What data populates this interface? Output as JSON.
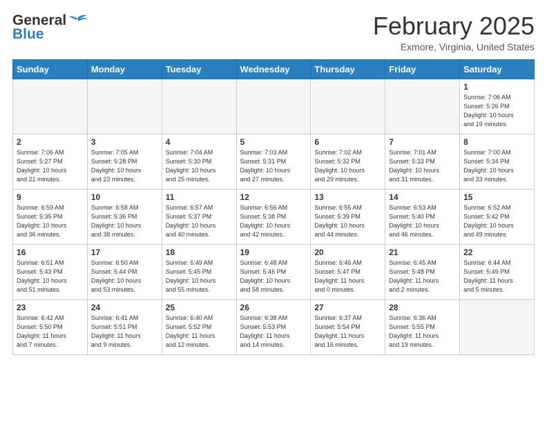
{
  "header": {
    "logo_general": "General",
    "logo_blue": "Blue",
    "month_title": "February 2025",
    "location": "Exmore, Virginia, United States"
  },
  "days_of_week": [
    "Sunday",
    "Monday",
    "Tuesday",
    "Wednesday",
    "Thursday",
    "Friday",
    "Saturday"
  ],
  "weeks": [
    [
      {
        "day": "",
        "info": ""
      },
      {
        "day": "",
        "info": ""
      },
      {
        "day": "",
        "info": ""
      },
      {
        "day": "",
        "info": ""
      },
      {
        "day": "",
        "info": ""
      },
      {
        "day": "",
        "info": ""
      },
      {
        "day": "1",
        "info": "Sunrise: 7:06 AM\nSunset: 5:26 PM\nDaylight: 10 hours\nand 19 minutes."
      }
    ],
    [
      {
        "day": "2",
        "info": "Sunrise: 7:06 AM\nSunset: 5:27 PM\nDaylight: 10 hours\nand 21 minutes."
      },
      {
        "day": "3",
        "info": "Sunrise: 7:05 AM\nSunset: 5:28 PM\nDaylight: 10 hours\nand 23 minutes."
      },
      {
        "day": "4",
        "info": "Sunrise: 7:04 AM\nSunset: 5:30 PM\nDaylight: 10 hours\nand 25 minutes."
      },
      {
        "day": "5",
        "info": "Sunrise: 7:03 AM\nSunset: 5:31 PM\nDaylight: 10 hours\nand 27 minutes."
      },
      {
        "day": "6",
        "info": "Sunrise: 7:02 AM\nSunset: 5:32 PM\nDaylight: 10 hours\nand 29 minutes."
      },
      {
        "day": "7",
        "info": "Sunrise: 7:01 AM\nSunset: 5:33 PM\nDaylight: 10 hours\nand 31 minutes."
      },
      {
        "day": "8",
        "info": "Sunrise: 7:00 AM\nSunset: 5:34 PM\nDaylight: 10 hours\nand 33 minutes."
      }
    ],
    [
      {
        "day": "9",
        "info": "Sunrise: 6:59 AM\nSunset: 5:35 PM\nDaylight: 10 hours\nand 36 minutes."
      },
      {
        "day": "10",
        "info": "Sunrise: 6:58 AM\nSunset: 5:36 PM\nDaylight: 10 hours\nand 38 minutes."
      },
      {
        "day": "11",
        "info": "Sunrise: 6:57 AM\nSunset: 5:37 PM\nDaylight: 10 hours\nand 40 minutes."
      },
      {
        "day": "12",
        "info": "Sunrise: 6:56 AM\nSunset: 5:38 PM\nDaylight: 10 hours\nand 42 minutes."
      },
      {
        "day": "13",
        "info": "Sunrise: 6:55 AM\nSunset: 5:39 PM\nDaylight: 10 hours\nand 44 minutes."
      },
      {
        "day": "14",
        "info": "Sunrise: 6:53 AM\nSunset: 5:40 PM\nDaylight: 10 hours\nand 46 minutes."
      },
      {
        "day": "15",
        "info": "Sunrise: 6:52 AM\nSunset: 5:42 PM\nDaylight: 10 hours\nand 49 minutes."
      }
    ],
    [
      {
        "day": "16",
        "info": "Sunrise: 6:51 AM\nSunset: 5:43 PM\nDaylight: 10 hours\nand 51 minutes."
      },
      {
        "day": "17",
        "info": "Sunrise: 6:50 AM\nSunset: 5:44 PM\nDaylight: 10 hours\nand 53 minutes."
      },
      {
        "day": "18",
        "info": "Sunrise: 6:49 AM\nSunset: 5:45 PM\nDaylight: 10 hours\nand 55 minutes."
      },
      {
        "day": "19",
        "info": "Sunrise: 6:48 AM\nSunset: 5:46 PM\nDaylight: 10 hours\nand 58 minutes."
      },
      {
        "day": "20",
        "info": "Sunrise: 6:46 AM\nSunset: 5:47 PM\nDaylight: 11 hours\nand 0 minutes."
      },
      {
        "day": "21",
        "info": "Sunrise: 6:45 AM\nSunset: 5:48 PM\nDaylight: 11 hours\nand 2 minutes."
      },
      {
        "day": "22",
        "info": "Sunrise: 6:44 AM\nSunset: 5:49 PM\nDaylight: 11 hours\nand 5 minutes."
      }
    ],
    [
      {
        "day": "23",
        "info": "Sunrise: 6:42 AM\nSunset: 5:50 PM\nDaylight: 11 hours\nand 7 minutes."
      },
      {
        "day": "24",
        "info": "Sunrise: 6:41 AM\nSunset: 5:51 PM\nDaylight: 11 hours\nand 9 minutes."
      },
      {
        "day": "25",
        "info": "Sunrise: 6:40 AM\nSunset: 5:52 PM\nDaylight: 11 hours\nand 12 minutes."
      },
      {
        "day": "26",
        "info": "Sunrise: 6:38 AM\nSunset: 5:53 PM\nDaylight: 11 hours\nand 14 minutes."
      },
      {
        "day": "27",
        "info": "Sunrise: 6:37 AM\nSunset: 5:54 PM\nDaylight: 11 hours\nand 16 minutes."
      },
      {
        "day": "28",
        "info": "Sunrise: 6:36 AM\nSunset: 5:55 PM\nDaylight: 11 hours\nand 19 minutes."
      },
      {
        "day": "",
        "info": ""
      }
    ]
  ]
}
